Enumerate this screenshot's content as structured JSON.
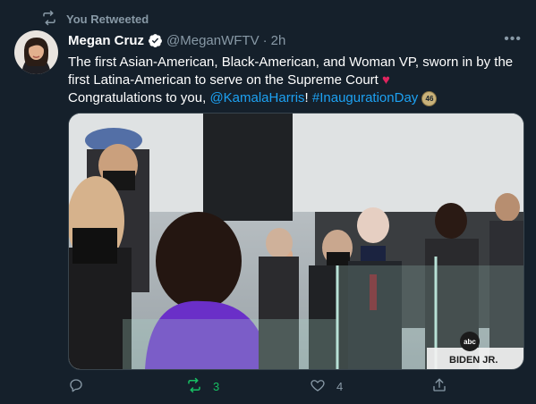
{
  "retweet_banner": {
    "text": "You Retweeted"
  },
  "tweet": {
    "author_name": "Megan Cruz",
    "handle": "@MeganWFTV",
    "separator": "·",
    "time": "2h",
    "more_label": "•••",
    "text_part1": "The first Asian-American, Black-American, and Woman VP, sworn in by the first Latina-American to serve on the Supreme Court",
    "heart": "♥",
    "text_part2": "Congratulations to you, ",
    "mention": "@KamalaHarris",
    "text_part3": "! ",
    "hashtag": "#InaugurationDay",
    "hashtag_badge": "46",
    "media_caption": "BIDEN JR.",
    "media_logo": "abc"
  },
  "actions": {
    "reply_count": "",
    "retweet_count": "3",
    "like_count": "4"
  },
  "colors": {
    "background": "#15202b",
    "secondary_text": "#8899a6",
    "link": "#1da1f2",
    "retweet_active": "#17bf63"
  }
}
